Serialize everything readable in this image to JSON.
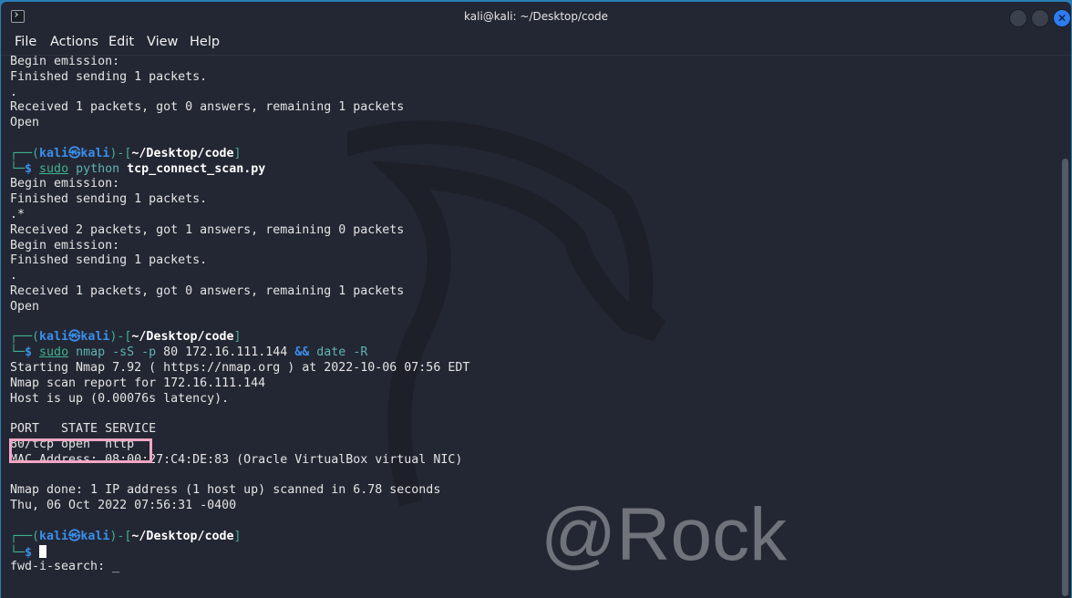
{
  "window": {
    "title": "kali@kali: ~/Desktop/code",
    "close_glyph": "✕"
  },
  "menu": [
    "File",
    "Actions",
    "Edit",
    "View",
    "Help"
  ],
  "prompt": {
    "user": "kali",
    "host": "kali",
    "at": "㉿",
    "path": "~/Desktop/code",
    "dollar": "$"
  },
  "lines": {
    "l1": "Begin emission:",
    "l2": "Finished sending 1 packets.",
    "l3": ".",
    "l4": "Received 1 packets, got 0 answers, remaining 1 packets",
    "l5": "Open",
    "cmd1_sudo": "sudo",
    "cmd1_rest": " python ",
    "cmd1_script": "tcp_connect_scan.py",
    "l6": "Begin emission:",
    "l7": "Finished sending 1 packets.",
    "l8": ".*",
    "l9": "Received 2 packets, got 1 answers, remaining 0 packets",
    "l10": "Begin emission:",
    "l11": "Finished sending 1 packets.",
    "l12": ".",
    "l13": "Received 1 packets, got 0 answers, remaining 1 packets",
    "l14": "Open",
    "cmd2_sudo": "sudo",
    "cmd2_a": " nmap -sS -p ",
    "cmd2_b": "80 172.16.111.144 ",
    "cmd2_and": "&&",
    "cmd2_c": " date -R",
    "n1": "Starting Nmap 7.92 ( https://nmap.org ) at 2022-10-06 07:56 EDT",
    "n2": "Nmap scan report for 172.16.111.144",
    "n3": "Host is up (0.00076s latency).",
    "n4": "PORT   STATE SERVICE",
    "n5": "80/tcp open  http",
    "n6": "MAC Address: 08:00:27:C4:DE:83 (Oracle VirtualBox virtual NIC)",
    "n7": "Nmap done: 1 IP address (1 host up) scanned in 6.78 seconds",
    "n8": "Thu, 06 Oct 2022 07:56:31 -0400",
    "search": "fwd-i-search: _"
  },
  "watermark": "@Rock"
}
